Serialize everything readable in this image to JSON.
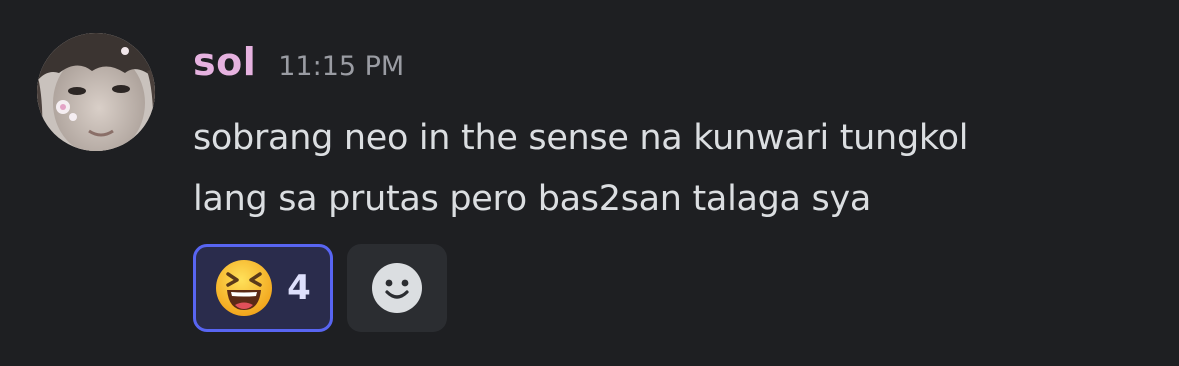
{
  "message": {
    "username": "sol",
    "timestamp": "11:15 PM",
    "content_lines": [
      "sobrang neo in the sense na kunwari tungkol",
      "lang sa prutas pero bas2san talaga sya"
    ],
    "avatar": "user-avatar-photo"
  },
  "reactions": [
    {
      "emoji": "laughing-squinting-emoji",
      "count": "4",
      "selected": true
    }
  ],
  "add_reaction": {
    "icon": "smiley-face-icon"
  },
  "colors": {
    "background": "#1e1f22",
    "username": "#e6b2e0",
    "timestamp": "#9a9ca3",
    "text": "#dbdee1",
    "reaction_bg": "#2a2c4c",
    "reaction_border": "#5865f2",
    "add_reaction_bg": "#2b2d31"
  }
}
